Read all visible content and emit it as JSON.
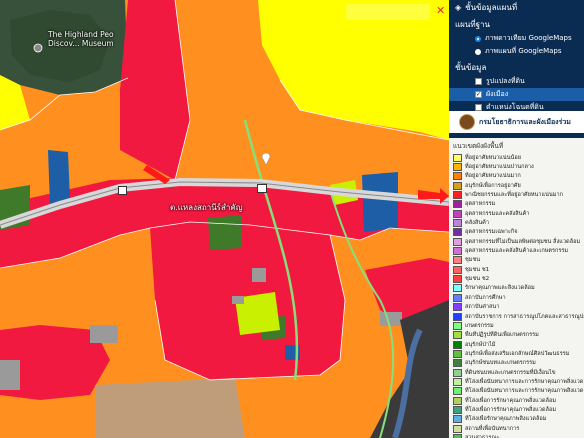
{
  "map": {
    "poi_label_line1": "The Highland Peo",
    "poi_label_line2": "Discov... Museum",
    "place_label": "ต.แหลงสถานีร์สำคัญ",
    "road_shield": "",
    "search_placeholder": "",
    "colors": {
      "red": "#f1193f",
      "orange": "#ff9020",
      "yellow": "#ffff00",
      "forest": "#3f7a2a",
      "brown": "#bf9d7a",
      "blue": "#1d5ea6",
      "lime": "#c8f000",
      "gray": "#9a9a9a",
      "road": "#d8d8d8"
    }
  },
  "panel": {
    "header": "ชั้นข้อมูลแผนที่",
    "basemap_title": "แผนที่ฐาน",
    "basemap_options": [
      {
        "label": "ภาพดาวเทียม GoogleMaps",
        "selected": true
      },
      {
        "label": "ภาพแผนที่ GoogleMaps",
        "selected": false
      }
    ],
    "layers_title": "ชั้นข้อมูล",
    "layers": [
      {
        "label": "รูปแปลงที่ดิน",
        "checked": false
      },
      {
        "label": "ผังเมือง",
        "checked": true
      },
      {
        "label": "ตำแหน่งโฉนดที่ดิน",
        "checked": false
      },
      {
        "label": "สำนักงานช่างรังวัดเอกชน",
        "checked": false
      }
    ],
    "agency": "กรมโยธาธิการและผังเมืองร่วม",
    "legend_title": "แนวเขตผังผังพื้นที่",
    "legend": [
      {
        "label": "ที่อยู่อาศัยหนาแน่นน้อย",
        "color": "#ffff66"
      },
      {
        "label": "ที่อยู่อาศัยหนาแน่นปานกลาง",
        "color": "#ffb400"
      },
      {
        "label": "ที่อยู่อาศัยหนาแน่นมาก",
        "color": "#ff8000"
      },
      {
        "label": "อนุรักษ์เพื่อการอยู่อาศัย",
        "color": "#d4a020"
      },
      {
        "label": "พาณิชยกรรมและที่อยู่อาศัยหนาแน่นมาก",
        "color": "#ff2020"
      },
      {
        "label": "อุตสาหกรรม",
        "color": "#a020a0"
      },
      {
        "label": "อุตสาหกรรมและคลังสินค้า",
        "color": "#c040c0"
      },
      {
        "label": "คลังสินค้า",
        "color": "#c080e0"
      },
      {
        "label": "อุตสาหกรรมเฉพาะกิจ",
        "color": "#7030a0"
      },
      {
        "label": "อุตสาหกรรมที่ไม่เป็นมลพิษต่อชุมชน สิ่งแวดล้อม",
        "color": "#e0a0e0"
      },
      {
        "label": "อุตสาหกรรมและคลังสินค้าและเกษตรกรรม",
        "color": "#d070d0"
      },
      {
        "label": "ชุมชน",
        "color": "#ff8080"
      },
      {
        "label": "ชุมชน ช1",
        "color": "#ff6060"
      },
      {
        "label": "ชุมชน ช2",
        "color": "#ff4040"
      },
      {
        "label": "รักษาคุณภาพและสิ่งแวดล้อม",
        "color": "#80ffff"
      },
      {
        "label": "สถาบันการศึกษา",
        "color": "#6080ff"
      },
      {
        "label": "สถาบันศาสนา",
        "color": "#8040ff"
      },
      {
        "label": "สถาบันราชการ การสาธารณูปโภคและสาธารณูปการ",
        "color": "#2040ff"
      },
      {
        "label": "เกษตรกรรม",
        "color": "#80ff80"
      },
      {
        "label": "พื้นที่ปฏิรูปที่ดินเพื่อเกษตรกรรม",
        "color": "#a0e040"
      },
      {
        "label": "อนุรักษ์ป่าไม้",
        "color": "#008000"
      },
      {
        "label": "อนุรักษ์เพื่อส่งเสริมเอกลักษณ์ศิลปวัฒนธรรม",
        "color": "#60c040"
      },
      {
        "label": "อนุรักษ์ชนบทและเกษตรกรรม",
        "color": "#408040"
      },
      {
        "label": "ที่ดินชนบทและเกษตรกรรมที่มีเงื่อนไข",
        "color": "#90d090"
      },
      {
        "label": "ที่โล่งเพื่อนันทนาการและการรักษาคุณภาพสิ่งแวดล้อม",
        "color": "#c0f0a0"
      },
      {
        "label": "ที่โล่งเพื่อนันทนาการและการรักษาคุณภาพสิ่งแวดล้อม",
        "color": "#70f070"
      },
      {
        "label": "ที่โล่งเพื่อการรักษาคุณภาพสิ่งแวดล้อม",
        "color": "#b0d060"
      },
      {
        "label": "ที่โล่งเพื่อการรักษาคุณภาพสิ่งแวดล้อม",
        "color": "#40a080"
      },
      {
        "label": "ที่โล่งเพื่อรักษาคุณภาพสิ่งแวดล้อม",
        "color": "#60b0e0"
      },
      {
        "label": "สถานที่เพื่อนันทนาการ",
        "color": "#d0e0a0"
      },
      {
        "label": "สวนสาธารณะ",
        "color": "#50c050"
      },
      {
        "label": "ชนบทและเกษตรกรรม",
        "color": "#c0c040"
      }
    ]
  }
}
